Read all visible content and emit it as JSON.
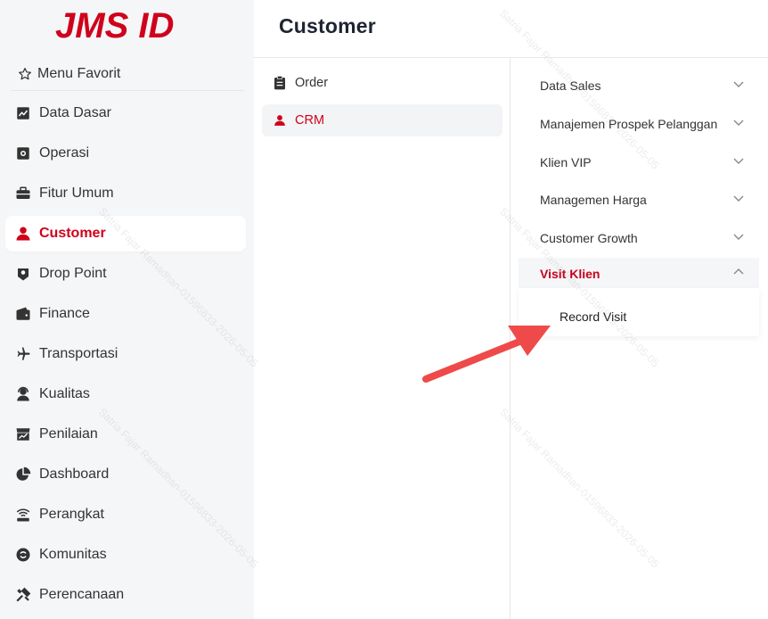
{
  "brand": {
    "logo_text": "JMS ID",
    "accent": "#d0021b"
  },
  "sidebar": {
    "favorites_label": "Menu Favorit",
    "items": [
      {
        "label": "Data Dasar",
        "icon": "chart-icon"
      },
      {
        "label": "Operasi",
        "icon": "operation-icon"
      },
      {
        "label": "Fitur Umum",
        "icon": "briefcase-icon"
      },
      {
        "label": "Customer",
        "icon": "user-icon",
        "active": true
      },
      {
        "label": "Drop Point",
        "icon": "location-icon"
      },
      {
        "label": "Finance",
        "icon": "wallet-icon"
      },
      {
        "label": "Transportasi",
        "icon": "plane-icon"
      },
      {
        "label": "Kualitas",
        "icon": "agent-icon"
      },
      {
        "label": "Penilaian",
        "icon": "store-chart-icon"
      },
      {
        "label": "Dashboard",
        "icon": "pie-chart-icon"
      },
      {
        "label": "Perangkat",
        "icon": "wifi-router-icon"
      },
      {
        "label": "Komunitas",
        "icon": "community-icon"
      },
      {
        "label": "Perencanaan",
        "icon": "tools-icon"
      }
    ]
  },
  "header": {
    "title": "Customer"
  },
  "middle": {
    "items": [
      {
        "label": "Order",
        "icon": "clipboard-icon"
      },
      {
        "label": "CRM",
        "icon": "user-icon",
        "active": true
      }
    ]
  },
  "right": {
    "items": [
      {
        "label": "Data Sales"
      },
      {
        "label": "Manajemen Prospek Pelanggan"
      },
      {
        "label": "Klien VIP"
      },
      {
        "label": "Managemen Harga"
      },
      {
        "label": "Customer Growth"
      },
      {
        "label": "Visit Klien",
        "open": true
      }
    ],
    "sub_items": [
      {
        "label": "Record Visit"
      }
    ]
  },
  "watermark": "Satria Fajar Ramadhan-01596833-2026-05-05",
  "annotation": {
    "arrow_color": "#ef4444"
  }
}
